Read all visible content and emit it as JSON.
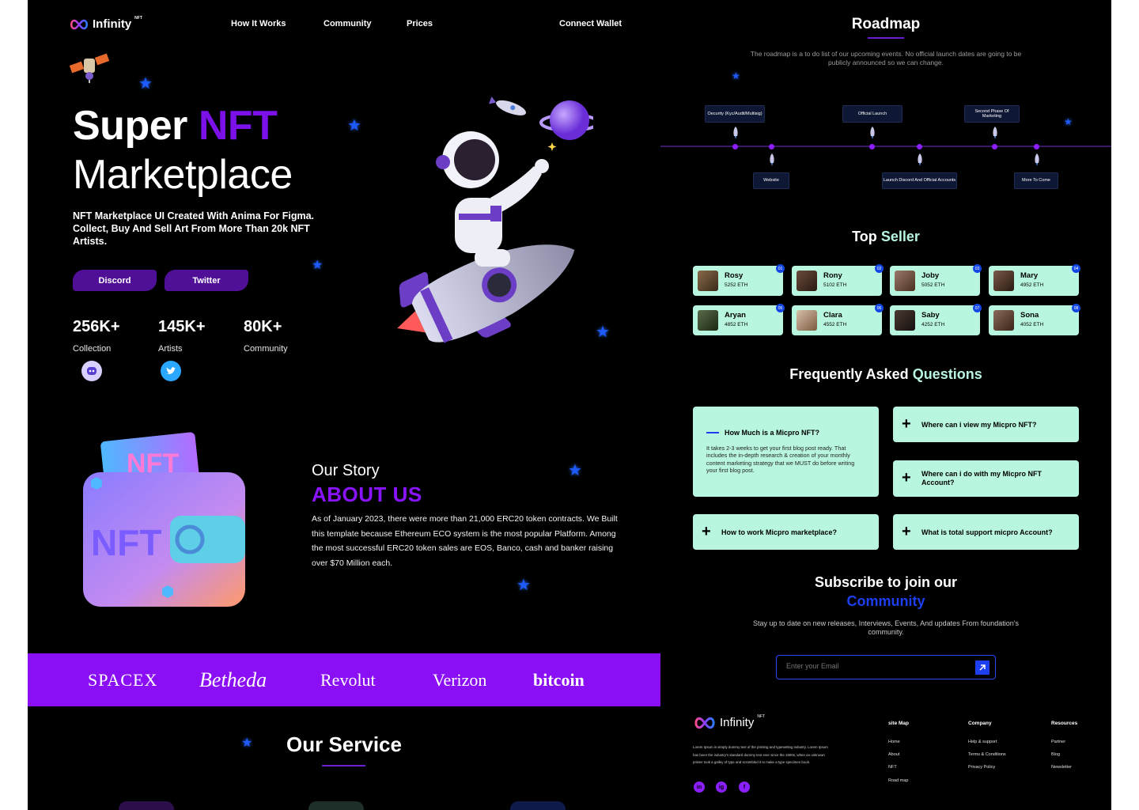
{
  "nav": {
    "logo_text": "Infinity",
    "logo_sup": "NFT",
    "links": [
      "How It Works",
      "Community",
      "Prices"
    ],
    "connect_wallet": "Connect Wallet"
  },
  "hero": {
    "title_word1": "Super",
    "title_word2": "NFT",
    "title_line2": "Marketplace",
    "description": "NFT Marketplace UI Created With Anima For Figma. Collect, Buy And Sell Art From More Than 20k NFT Artists.",
    "buttons": [
      "Discord",
      "Twitter"
    ],
    "stats": [
      {
        "value": "256K+",
        "label": "Collection"
      },
      {
        "value": "145K+",
        "label": "Artists"
      },
      {
        "value": "80K+",
        "label": "Community"
      }
    ]
  },
  "about": {
    "subtitle": "Our Story",
    "title": "ABOUT US",
    "text": "As of January 2023, there were more than 21,000 ERC20 token contracts. We Built this template because Ethereum ECO system is the most popular Platform. Among the most successful ERC20 token sales are EOS, Banco, cash and banker raising over $70 Million each."
  },
  "brands": [
    "SPACEX",
    "Betheda",
    "Revolut",
    "Verizon",
    "bitcoin"
  ],
  "service": {
    "title": "Our Service"
  },
  "roadmap": {
    "title": "Roadmap",
    "description": "The roadmap is a to do list of our upcoming events. No official launch dates are going to be publicly announced so we can change.",
    "top_items": [
      "Oecurity (Kyc/Audit/Multisig)",
      "Official Launch",
      "Second Phase Of Marketing"
    ],
    "bottom_items": [
      "Website",
      "Launch Discord And Official Accounts",
      "More To Come"
    ]
  },
  "top_seller": {
    "title_word1": "Top",
    "title_word2": "Seller",
    "sellers": [
      {
        "name": "Rosy",
        "eth": "5252 ETH",
        "rank": "01"
      },
      {
        "name": "Rony",
        "eth": "5102 ETH",
        "rank": "02"
      },
      {
        "name": "Joby",
        "eth": "5052 ETH",
        "rank": "03"
      },
      {
        "name": "Mary",
        "eth": "4952 ETH",
        "rank": "04"
      },
      {
        "name": "Aryan",
        "eth": "4852 ETH",
        "rank": "05"
      },
      {
        "name": "Clara",
        "eth": "4552 ETH",
        "rank": "06"
      },
      {
        "name": "Saby",
        "eth": "4252 ETH",
        "rank": "07"
      },
      {
        "name": "Sona",
        "eth": "4052 ETH",
        "rank": "08"
      }
    ]
  },
  "faq": {
    "title_word1": "Frequently Asked",
    "title_word2": "Questions",
    "open_question": "How Much is a Micpro NFT?",
    "open_answer": "It takes 2-3 weeks to get your first blog post ready. That includes the in-depth research & creation of your monthly content marketing strategy that we MUST do before writing your first blog post.",
    "questions": [
      "Where can i view my Micpro NFT?",
      "Where can i do with my Micpro NFT Account?",
      "How to work Micpro marketplace?",
      "What is total support micpro Account?"
    ]
  },
  "subscribe": {
    "title_line1": "Subscribe to join our",
    "title_line2": "Community",
    "description": "Stay up to date on new releases, Interviews, Events, And updates From foundation's community.",
    "placeholder": "Enter your Email"
  },
  "footer": {
    "logo_text": "Infinity",
    "logo_sup": "NFT",
    "about": "Lorem Ipsum is simply dummy text of the printing and typesetting industry. Lorem Ipsum has been the industry's standard dummy text ever since the 1500s, when an unknown printer took a galley of type and scrambled it to make a type specimen book.",
    "columns": [
      {
        "heading": "site Map",
        "links": [
          "Home",
          "About",
          "NFT",
          "Road map"
        ]
      },
      {
        "heading": "Company",
        "links": [
          "Help & support",
          "Terms & Conditions",
          "Privacy Policy"
        ]
      },
      {
        "heading": "Resources",
        "links": [
          "Partner",
          "Blog",
          "Newsletter"
        ]
      }
    ],
    "social": [
      "in",
      "ig",
      "f"
    ]
  },
  "colors": {
    "accent_purple": "#7b10e8",
    "brand_bar": "#8a0ff5",
    "mint": "#b9f6df",
    "blue": "#1d3ff0"
  }
}
